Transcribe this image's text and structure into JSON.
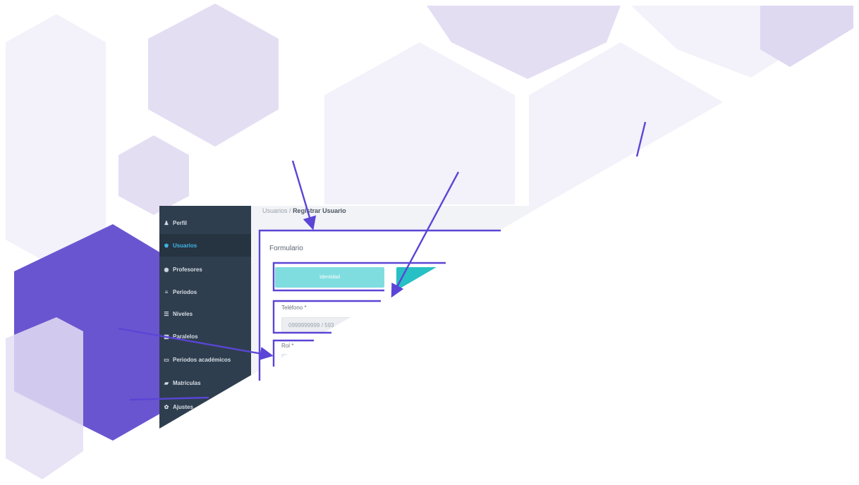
{
  "breadcrumb": {
    "parent": "Usuarios",
    "separator": "/",
    "current": "Registrar Usuario"
  },
  "sidebar": {
    "items": [
      {
        "label": "Perfil",
        "icon": "user-icon",
        "glyph": "♟"
      },
      {
        "label": "Usuarios",
        "icon": "users-icon",
        "glyph": "♚",
        "active": true
      },
      {
        "label": "Profesores",
        "icon": "person-circle-icon",
        "glyph": "◉"
      },
      {
        "label": "Periodos",
        "icon": "list-icon",
        "glyph": "≡"
      },
      {
        "label": "Niveles",
        "icon": "list-bullets-icon",
        "glyph": "☰"
      },
      {
        "label": "Paralelos",
        "icon": "grid-icon",
        "glyph": "▦"
      },
      {
        "label": "Periodos académicos",
        "icon": "calendar-icon",
        "glyph": "▭"
      },
      {
        "label": "Matrículas",
        "icon": "book-icon",
        "glyph": "▰"
      },
      {
        "label": "Ajustes",
        "icon": "gear-icon",
        "glyph": "✿"
      }
    ]
  },
  "form": {
    "title": "Formulario",
    "tabs": [
      {
        "label": "Identidad"
      },
      {
        "label": ""
      }
    ],
    "phone_label": "Teléfono *",
    "phone_placeholder": "0999999999 / 593",
    "role_label": "Rol *"
  },
  "colors": {
    "sidebar_bg": "#2f3e4e",
    "accent_blue": "#3fb6e6",
    "tab_light": "#7fdde0",
    "tab_dark": "#27c0c4",
    "annotation": "#5a45d6",
    "hexagon_light": "#e4def3",
    "hexagon_dark": "#6a55d0"
  }
}
